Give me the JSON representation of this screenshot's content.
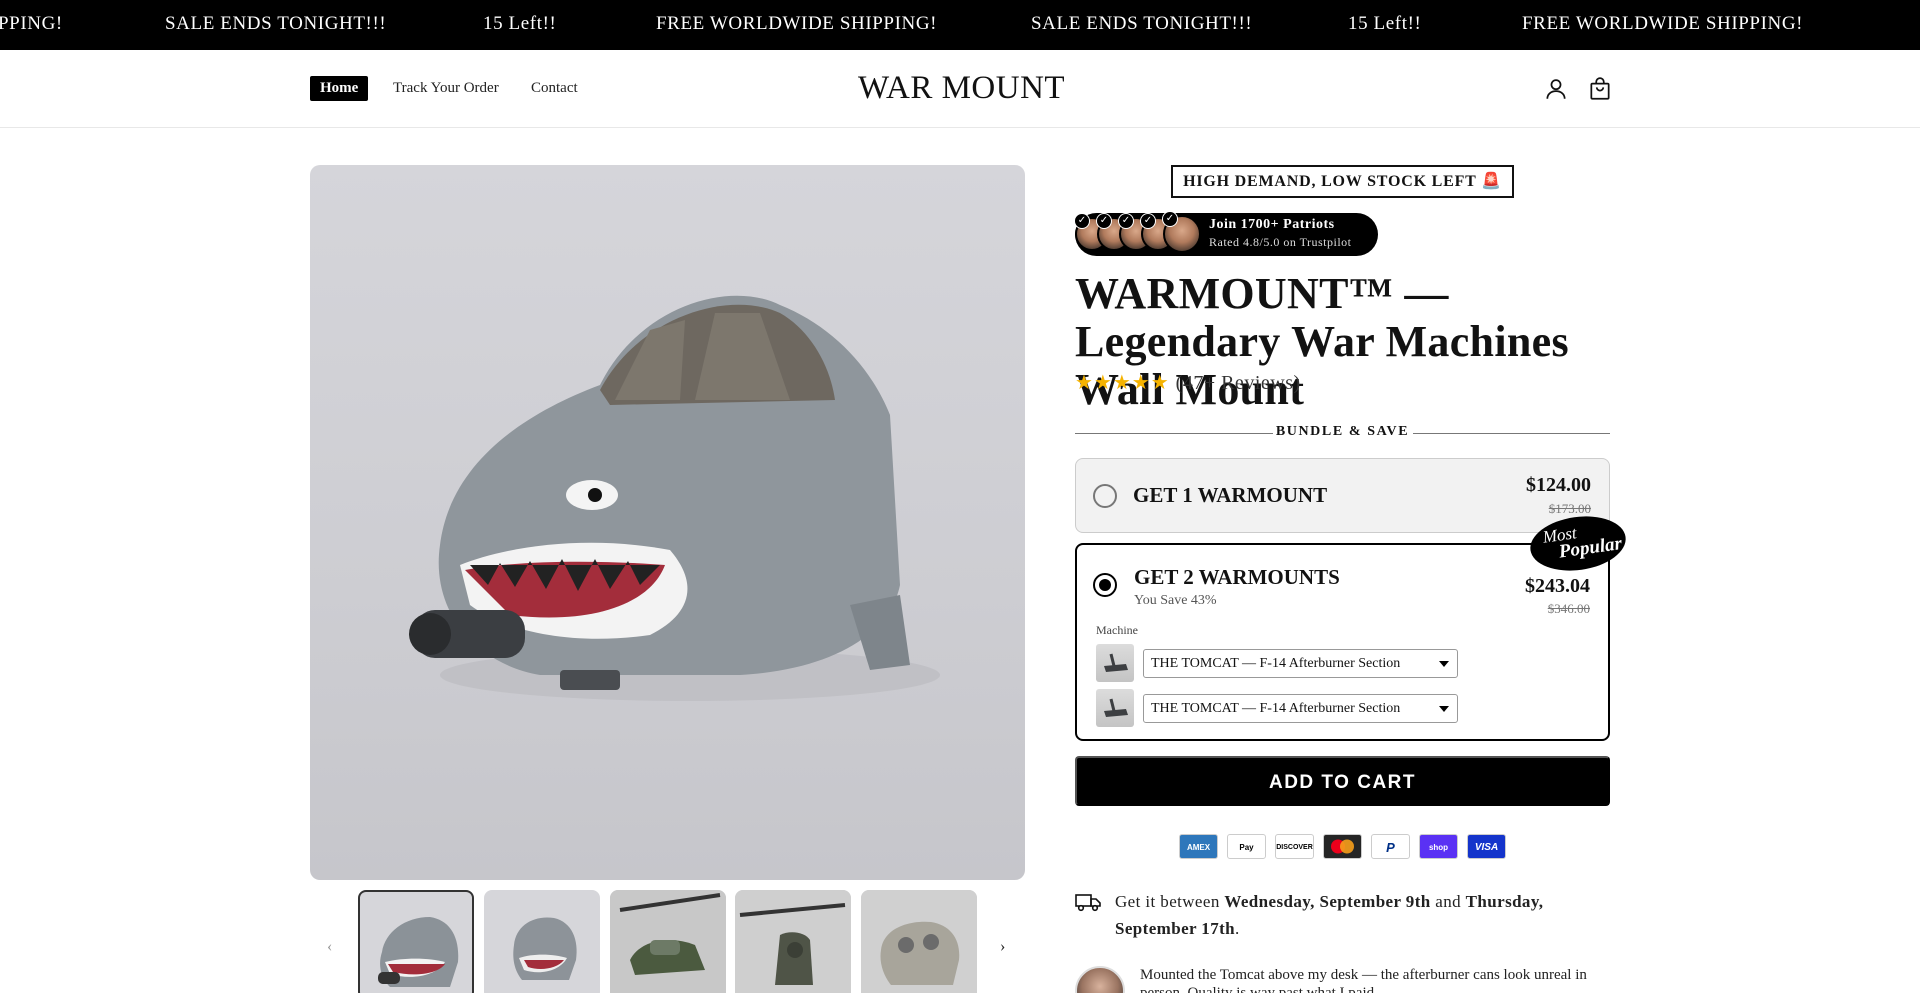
{
  "announcement": {
    "items": [
      "PPING!",
      "SALE ENDS TONIGHT!!!",
      "15 Left!!",
      "FREE WORLDWIDE SHIPPING!",
      "SALE ENDS TONIGHT!!!",
      "15 Left!!",
      "FREE WORLDWIDE SHIPPING!"
    ]
  },
  "header": {
    "nav": [
      "Home",
      "Track Your Order",
      "Contact"
    ],
    "logo": "WAR MOUNT",
    "icons": [
      "account-icon",
      "cart-icon"
    ]
  },
  "gallery": {
    "thumbnails": 5
  },
  "product": {
    "stock_badge": "HIGH DEMAND, LOW STOCK LEFT 🚨",
    "social_title": "Join 1700+ Patriots",
    "social_sub": "Rated 4.8/5.0 on Trustpilot",
    "title": "WARMOUNT™ — Legendary War Machines Wall Mount",
    "stars": "★★★★★",
    "reviews": "(47+ Reviews)",
    "bundle_header": "BUNDLE & SAVE",
    "option1": {
      "label": "GET 1 WARMOUNT",
      "price": "$124.00",
      "compare": "$173.00"
    },
    "option2": {
      "label": "GET 2 WARMOUNTS",
      "save": "You Save 43%",
      "price": "$243.04",
      "compare": "$346.00",
      "machine_label": "Machine",
      "select1": "THE TOMCAT — F-14 Afterburner Section",
      "select2": "THE TOMCAT — F-14 Afterburner Section",
      "badge_line1": "Most",
      "badge_line2": "Popular"
    },
    "add_to_cart": "ADD TO CART",
    "payments": [
      "AMEX",
      "Pay",
      "DISCOVER",
      "mastercard",
      "P",
      "shop",
      "VISA"
    ],
    "delivery_prefix": "Get it between ",
    "delivery_start": "Wednesday, September 9th",
    "delivery_mid": " and ",
    "delivery_end": "Thursday, September 17th",
    "delivery_suffix": ".",
    "review_text": "Mounted the Tomcat above my desk — the afterburner cans look unreal in person. Quality is way past what I paid."
  },
  "colors": {
    "accent": "#000000",
    "star": "#f5b301"
  }
}
